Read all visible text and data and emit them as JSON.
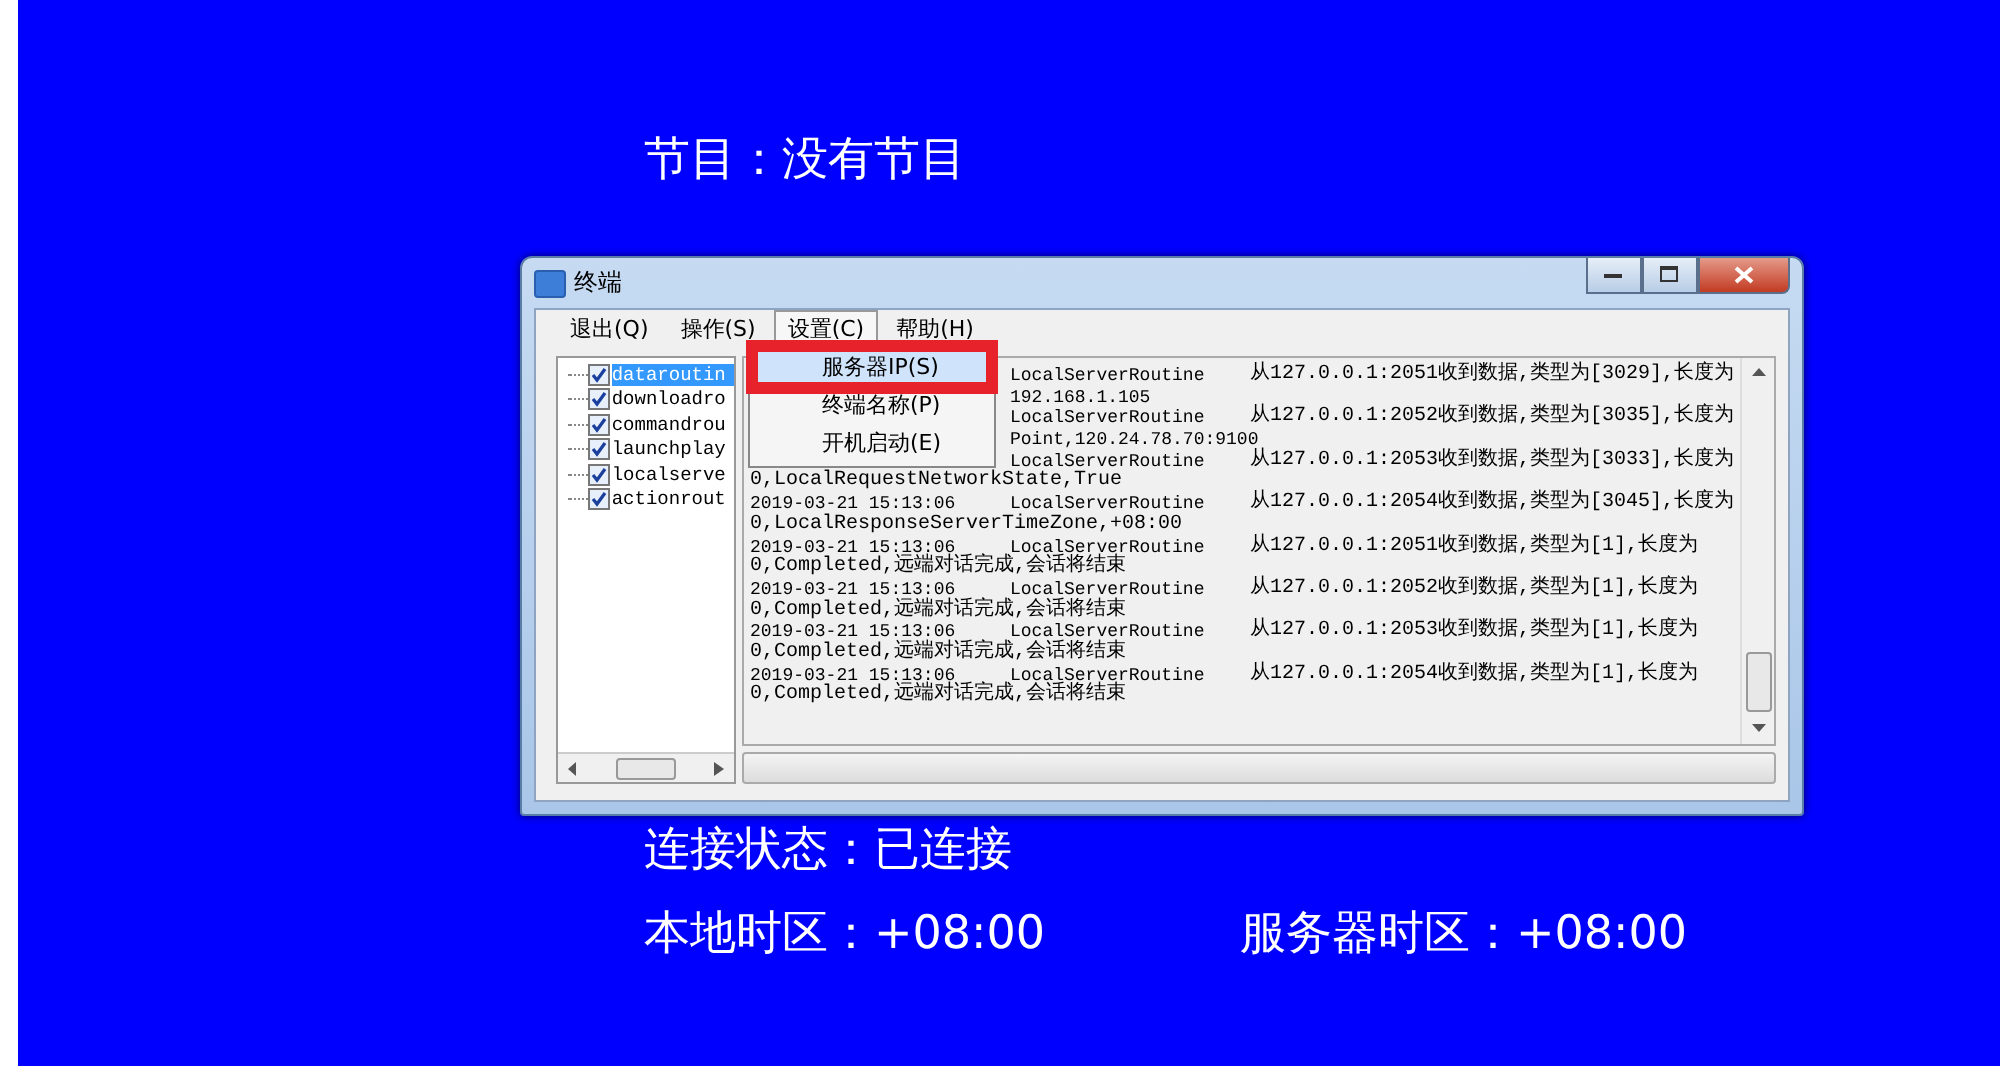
{
  "screen": {
    "program": "节目：没有节目",
    "connection": "连接状态：已连接",
    "local_timezone": "本地时区：+08:00",
    "server_timezone": "服务器时区：+08:00"
  },
  "window": {
    "title": "终端",
    "menu_bar": [
      {
        "label": "退出(Q)",
        "selected": false
      },
      {
        "label": "操作(S)",
        "selected": false
      },
      {
        "label": "设置(C)",
        "selected": true
      },
      {
        "label": "帮助(H)",
        "selected": false
      }
    ],
    "dropdown": [
      {
        "label": "服务器IP(S)",
        "selected": true
      },
      {
        "label": "终端名称(P)",
        "selected": false
      },
      {
        "label": "开机启动(E)",
        "selected": false
      }
    ],
    "tree": [
      {
        "label": "dataroutin",
        "checked": true,
        "selected": true
      },
      {
        "label": "downloadro",
        "checked": true,
        "selected": false
      },
      {
        "label": "commandrou",
        "checked": true,
        "selected": false
      },
      {
        "label": "launchplay",
        "checked": true,
        "selected": false
      },
      {
        "label": "localserve",
        "checked": true,
        "selected": false
      },
      {
        "label": "actionrout",
        "checked": true,
        "selected": false
      }
    ],
    "log": [
      {
        "kind": "covered",
        "source": "LocalServerRoutine",
        "message": "从127.0.0.1:2051收到数据,类型为[3029],长度为",
        "detail": "192.168.1.105"
      },
      {
        "kind": "covered",
        "source": "LocalServerRoutine",
        "message": "从127.0.0.1:2052收到数据,类型为[3035],长度为",
        "detail": "Point,120.24.78.70:9100"
      },
      {
        "kind": "full",
        "source": "LocalServerRoutine",
        "message": "从127.0.0.1:2053收到数据,类型为[3033],长度为",
        "detail": "0,LocalRequestNetworkState,True"
      },
      {
        "kind": "full",
        "time": "2019-03-21 15:13:06",
        "source": "LocalServerRoutine",
        "message": "从127.0.0.1:2054收到数据,类型为[3045],长度为",
        "detail": "0,LocalResponseServerTimeZone,+08:00"
      },
      {
        "kind": "full",
        "time": "2019-03-21 15:13:06",
        "source": "LocalServerRoutine",
        "message": "从127.0.0.1:2051收到数据,类型为[1],长度为",
        "detail": "0,Completed,远端对话完成,会话将结束"
      },
      {
        "kind": "full",
        "time": "2019-03-21 15:13:06",
        "source": "LocalServerRoutine",
        "message": "从127.0.0.1:2052收到数据,类型为[1],长度为",
        "detail": "0,Completed,远端对话完成,会话将结束"
      },
      {
        "kind": "full",
        "time": "2019-03-21 15:13:06",
        "source": "LocalServerRoutine",
        "message": "从127.0.0.1:2053收到数据,类型为[1],长度为",
        "detail": "0,Completed,远端对话完成,会话将结束"
      },
      {
        "kind": "full",
        "time": "2019-03-21 15:13:06",
        "source": "LocalServerRoutine",
        "message": "从127.0.0.1:2054收到数据,类型为[1],长度为",
        "detail": "0,Completed,远端对话完成,会话将结束"
      }
    ]
  }
}
